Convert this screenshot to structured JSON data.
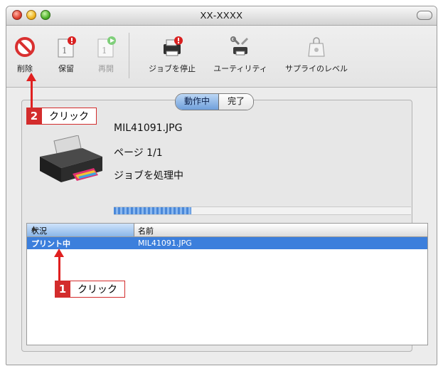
{
  "window": {
    "title": "XX-XXXX"
  },
  "toolbar": {
    "delete_label": "削除",
    "hold_label": "保留",
    "resume_label": "再開",
    "stop_jobs_label": "ジョブを停止",
    "utility_label": "ユーティリティ",
    "supply_label": "サプライのレベル"
  },
  "segmented": {
    "active": "動作中",
    "done": "完了"
  },
  "job": {
    "file": "MIL41091.JPG",
    "page": "ページ 1/1",
    "status": "ジョブを処理中",
    "progress": 0.26
  },
  "table": {
    "headers": {
      "status": "状況",
      "name": "名前"
    },
    "rows": [
      {
        "status": "プリント中",
        "name": "MIL41091.JPG"
      }
    ]
  },
  "callouts": [
    {
      "number": "2",
      "text": "クリック"
    },
    {
      "number": "1",
      "text": "クリック"
    }
  ],
  "colors": {
    "callout_red": "#d32c2c",
    "selection_blue": "#3c7fdc"
  }
}
